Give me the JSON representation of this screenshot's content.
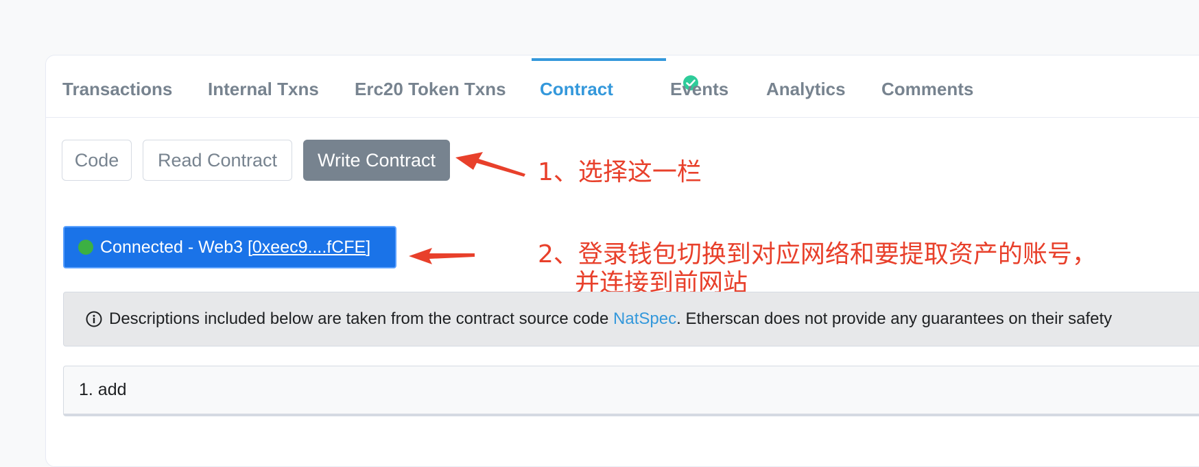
{
  "tabs": [
    {
      "label": "Transactions"
    },
    {
      "label": "Internal Txns"
    },
    {
      "label": "Erc20 Token Txns"
    },
    {
      "label": "Contract",
      "verified": true
    },
    {
      "label": "Events"
    },
    {
      "label": "Analytics"
    },
    {
      "label": "Comments"
    }
  ],
  "subtabs": [
    {
      "label": "Code"
    },
    {
      "label": "Read Contract"
    },
    {
      "label": "Write Contract",
      "active": true
    }
  ],
  "wallet": {
    "status": "Connected - Web3 [",
    "address": "0xeec9....fCFE",
    "close": "]"
  },
  "notice": {
    "text_before": "Descriptions included below are taken from the contract source code ",
    "link": "NatSpec",
    "text_after": ". Etherscan does not provide any guarantees on their safety"
  },
  "functions": [
    {
      "label": "1. add"
    }
  ],
  "annotations": {
    "step1": "1、选择这一栏",
    "step2_line1": "2、登录钱包切换到对应网络和要提取资产的账号，",
    "step2_line2": "并连接到前网站"
  },
  "colors": {
    "accent": "#3498db",
    "connected_bg": "#1a73e8",
    "annotation": "#e8402b",
    "active_subtab": "#77838f"
  }
}
